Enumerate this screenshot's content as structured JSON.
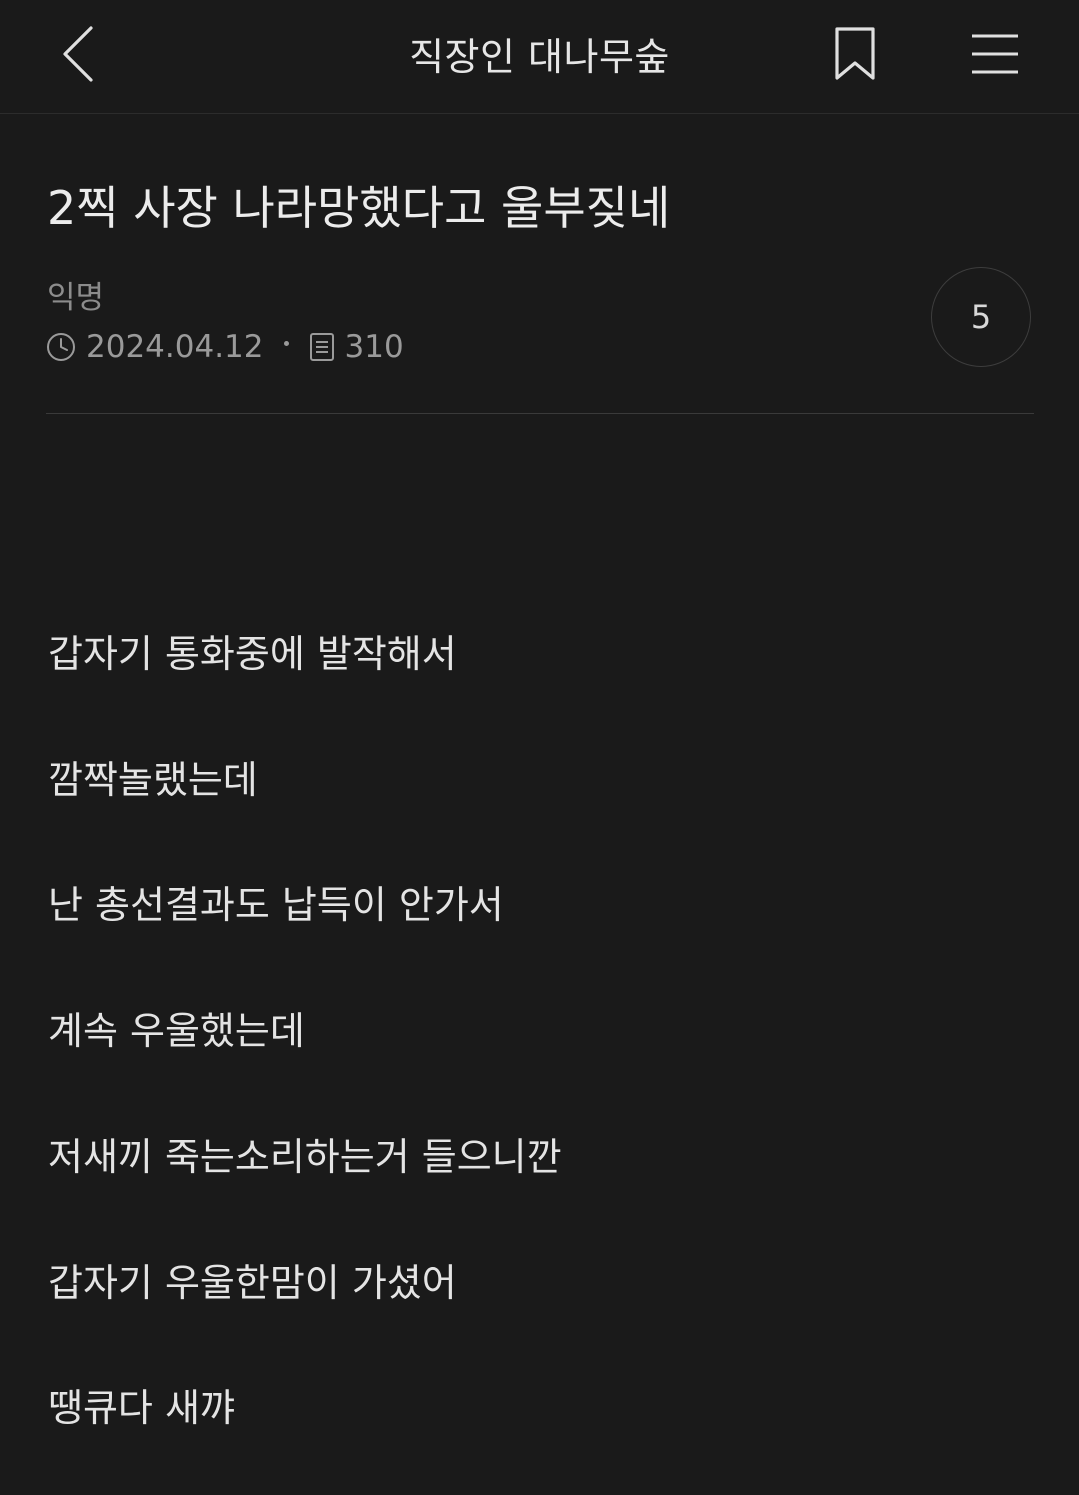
{
  "header": {
    "title": "직장인 대나무숲"
  },
  "post": {
    "title": "2찍 사장 나라망했다고 울부짖네",
    "author": "익명",
    "date": "2024.04.12",
    "views": "310",
    "comment_count": "5",
    "body": [
      "갑자기 통화중에 발작해서",
      "깜짝놀랬는데",
      "난 총선결과도 납득이 안가서",
      "계속 우울했는데",
      "저새끼 죽는소리하는거 들으니깐",
      "갑자기 우울한맘이 가셨어",
      "땡큐다 새꺄"
    ]
  },
  "icons": {
    "back": "chevron-left-icon",
    "bookmark": "bookmark-icon",
    "menu": "hamburger-menu-icon",
    "date": "clock-icon",
    "views": "document-icon"
  },
  "colors": {
    "background": "#1a1a1a",
    "text": "#e8e8e8",
    "muted": "#8c8c8c"
  }
}
